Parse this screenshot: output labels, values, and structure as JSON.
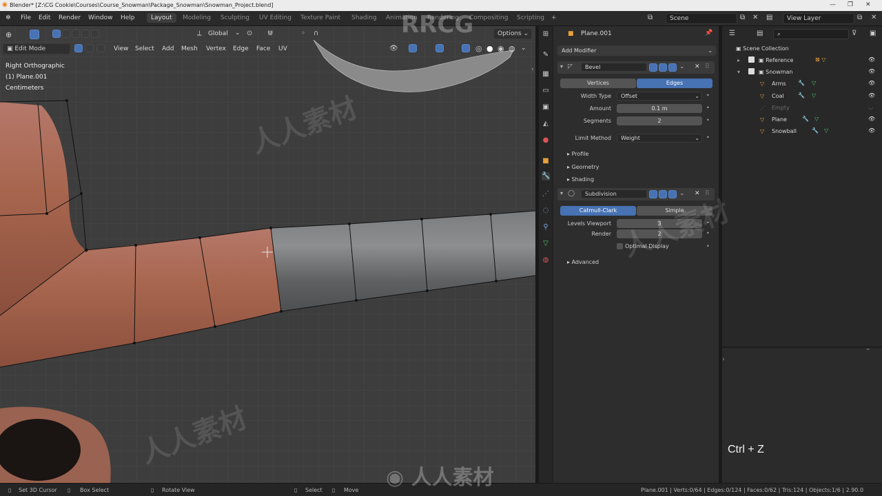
{
  "window": {
    "title": "Blender* [Z:\\CG Cookie\\Courses\\Course_Snowman\\Package_Snowman\\Snowman_Project.blend]"
  },
  "menu": [
    "File",
    "Edit",
    "Render",
    "Window",
    "Help"
  ],
  "workspaces": [
    {
      "label": "Layout",
      "active": true
    },
    {
      "label": "Modeling",
      "active": false
    },
    {
      "label": "Sculpting",
      "active": false
    },
    {
      "label": "UV Editing",
      "active": false
    },
    {
      "label": "Texture Paint",
      "active": false
    },
    {
      "label": "Shading",
      "active": false
    },
    {
      "label": "Animation",
      "active": false
    },
    {
      "label": "Rendering",
      "active": false
    },
    {
      "label": "Compositing",
      "active": false
    },
    {
      "label": "Scripting",
      "active": false
    }
  ],
  "scene": {
    "label": "Scene",
    "view_layer": "View Layer"
  },
  "viewport": {
    "mode": "Edit Mode",
    "orientation": "Global",
    "options_label": "Options",
    "header_menus": [
      "View",
      "Select",
      "Add",
      "Mesh",
      "Vertex",
      "Edge",
      "Face",
      "UV"
    ],
    "overlay_lines": [
      "Right Orthographic",
      "(1) Plane.001",
      "Centimeters"
    ]
  },
  "properties": {
    "object_name": "Plane.001",
    "add_modifier": "Add Modifier",
    "bevel": {
      "name": "Bevel",
      "tabs": [
        "Vertices",
        "Edges"
      ],
      "active_tab": "Edges",
      "width_type_label": "Width Type",
      "width_type": "Offset",
      "amount_label": "Amount",
      "amount": "0.1 m",
      "segments_label": "Segments",
      "segments": "2",
      "limit_method_label": "Limit Method",
      "limit_method": "Weight",
      "subpanels": [
        "Profile",
        "Geometry",
        "Shading"
      ]
    },
    "subdivision": {
      "name": "Subdivision",
      "tabs": [
        "Catmull-Clark",
        "Simple"
      ],
      "active_tab": "Catmull-Clark",
      "levels_viewport_label": "Levels Viewport",
      "levels_viewport": "3",
      "render_label": "Render",
      "render": "2",
      "optimal_display": "Optimal Display",
      "advanced": "Advanced"
    }
  },
  "outliner": {
    "root": "Scene Collection",
    "items": [
      {
        "label": "Reference",
        "level": 1
      },
      {
        "label": "Snowman",
        "level": 1
      },
      {
        "label": "Arms",
        "level": 2
      },
      {
        "label": "Coal",
        "level": 2
      },
      {
        "label": "Empty",
        "level": 2
      },
      {
        "label": "Plane",
        "level": 2
      },
      {
        "label": "Snowball",
        "level": 2
      }
    ]
  },
  "shortcut_overlay": "Ctrl + Z",
  "statusbar": {
    "left": [
      "Set 3D Cursor",
      "Box Select",
      "Rotate View",
      "Select",
      "Move"
    ],
    "stats": "Plane.001 | Verts:0/64 | Edges:0/124 | Faces:0/62 | Tris:124 | Objects:1/6 | 2.90.0"
  },
  "colors": {
    "accent": "#4772b3",
    "selected_mesh": "#b06a56",
    "mesh_gray": "#6c6e70"
  }
}
